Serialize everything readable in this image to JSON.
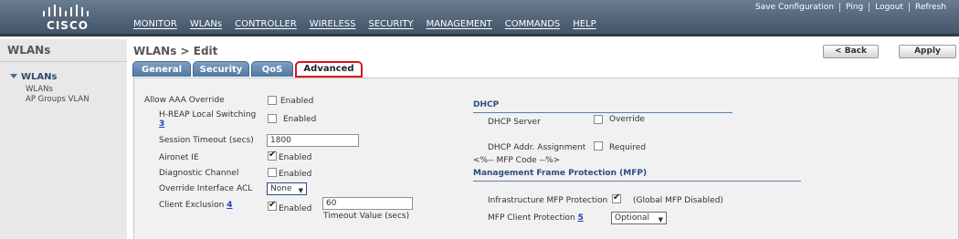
{
  "brand": {
    "logo_text": "CISCO"
  },
  "top_links": [
    "Save Configuration",
    "Ping",
    "Logout",
    "Refresh"
  ],
  "menu": [
    "MONITOR",
    "WLANs",
    "CONTROLLER",
    "WIRELESS",
    "SECURITY",
    "MANAGEMENT",
    "COMMANDS",
    "HELP"
  ],
  "sidebar": {
    "title": "WLANs",
    "group": "WLANs",
    "items": [
      "WLANs",
      "AP Groups VLAN"
    ]
  },
  "page": {
    "title": "WLANs > Edit",
    "back_label": "< Back",
    "apply_label": "Apply"
  },
  "tabs": [
    "General",
    "Security",
    "QoS",
    "Advanced"
  ],
  "active_tab": "Advanced",
  "form": {
    "aaa_override": {
      "label": "Allow AAA Override",
      "option": "Enabled",
      "checked": false
    },
    "hreap": {
      "label": "H-REAP Local Switching",
      "footnote": "3",
      "option": "Enabled",
      "checked": false
    },
    "session_timeout": {
      "label": "Session Timeout (secs)",
      "value": "1800"
    },
    "aironet_ie": {
      "label": "Aironet IE",
      "option": "Enabled",
      "checked": true
    },
    "diag_channel": {
      "label": "Diagnostic Channel",
      "option": "Enabled",
      "checked": false
    },
    "override_acl": {
      "label": "Override Interface ACL",
      "value": "None"
    },
    "client_exclusion": {
      "label": "Client Exclusion",
      "footnote": "4",
      "option": "Enabled",
      "checked": true,
      "timeout_value": "60",
      "timeout_label": "Timeout Value (secs)"
    }
  },
  "dhcp": {
    "title": "DHCP",
    "server": {
      "label": "DHCP Server",
      "option": "Override",
      "checked": false
    },
    "assignment": {
      "label": "DHCP Addr. Assignment",
      "option": "Required",
      "checked": false
    },
    "comment": "<%-- MFP Code --%>"
  },
  "mfp": {
    "title": "Management Frame Protection (MFP)",
    "infra": {
      "label": "Infrastructure MFP Protection",
      "note": "(Global MFP Disabled)",
      "checked": true
    },
    "client": {
      "label": "MFP Client Protection",
      "footnote": "5",
      "value": "Optional"
    }
  },
  "colors": {
    "header": "#4d5f73",
    "tab": "#4f76a1",
    "highlight": "#d8151b",
    "link": "#1f3fb8"
  }
}
